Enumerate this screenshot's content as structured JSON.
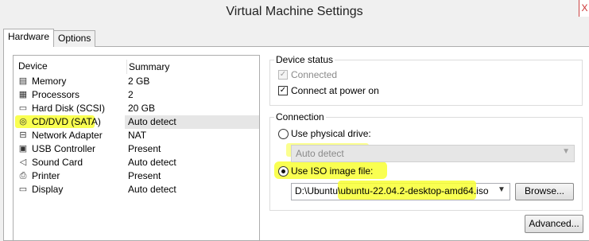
{
  "window": {
    "title": "Virtual Machine Settings",
    "close_label": "X"
  },
  "tabs": [
    {
      "label": "Hardware"
    },
    {
      "label": "Options"
    }
  ],
  "device_list": {
    "col_device": "Device",
    "col_summary": "Summary",
    "items": [
      {
        "name": "Memory",
        "summary": "2 GB",
        "icon": "memory-icon"
      },
      {
        "name": "Processors",
        "summary": "2",
        "icon": "processor-icon"
      },
      {
        "name": "Hard Disk (SCSI)",
        "summary": "20 GB",
        "icon": "hard-disk-icon"
      },
      {
        "name": "CD/DVD (SATA)",
        "summary": "Auto detect",
        "icon": "cd-dvd-icon"
      },
      {
        "name": "Network Adapter",
        "summary": "NAT",
        "icon": "network-adapter-icon"
      },
      {
        "name": "USB Controller",
        "summary": "Present",
        "icon": "usb-icon"
      },
      {
        "name": "Sound Card",
        "summary": "Auto detect",
        "icon": "speaker-icon"
      },
      {
        "name": "Printer",
        "summary": "Present",
        "icon": "printer-icon"
      },
      {
        "name": "Display",
        "summary": "Auto detect",
        "icon": "display-icon"
      }
    ]
  },
  "device_status": {
    "title": "Device status",
    "connected_label": "Connected",
    "connected_checked": true,
    "connect_at_power_on_label": "Connect at power on",
    "connect_at_power_on_checked": true
  },
  "connection": {
    "title": "Connection",
    "use_physical_drive_label": "Use physical drive:",
    "physical_drive_value": "Auto detect",
    "use_iso_label": "Use ISO image file:",
    "iso_path_prefix": "D:\\Ubuntu\\",
    "iso_file_name": "ubuntu-22.04.2-desktop-amd64.iso",
    "selected": "iso",
    "browse_label": "Browse..."
  },
  "advanced_label": "Advanced...",
  "colors": {
    "highlight": "#f8ff33",
    "selected_row": "#e6e6e6",
    "close_red": "#c33"
  }
}
